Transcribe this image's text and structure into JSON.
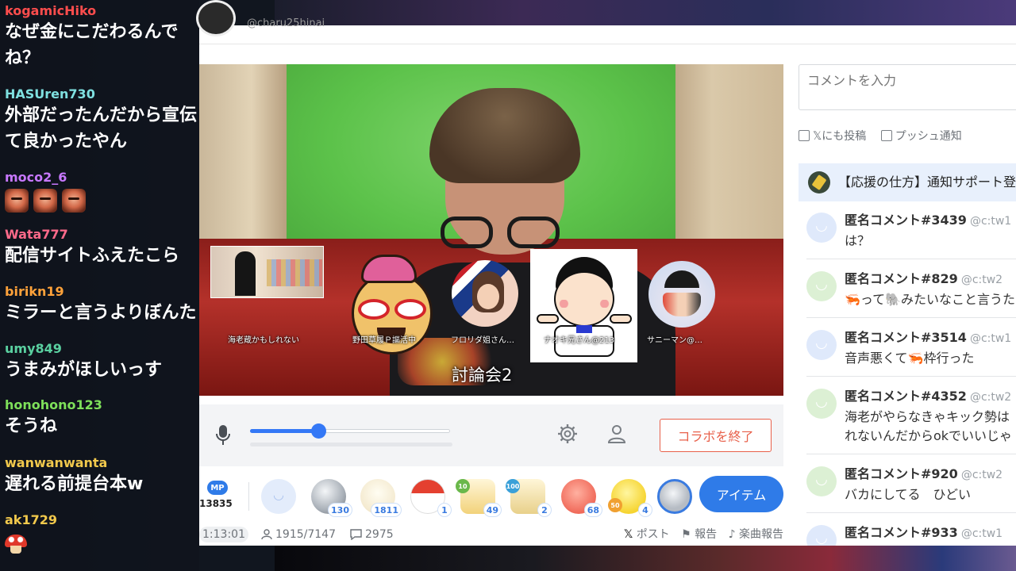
{
  "chat": {
    "messages": [
      {
        "user": "kogamicHiko",
        "color": "#ff4d4d",
        "lines": [
          "なぜ金にこだわるんで",
          "ね？"
        ]
      },
      {
        "user": "HASUren730",
        "color": "#7fe0e0",
        "lines": [
          "外部だったんだから宣伝",
          "て良かったやん"
        ]
      },
      {
        "user": "moco2_6",
        "color": "#c878ff",
        "lines": [],
        "emotes": [
          "face-emote",
          "face-emote",
          "face-emote"
        ]
      },
      {
        "user": "Wata777",
        "color": "#ff6a8a",
        "lines": [
          "配信サイトふえたこら"
        ]
      },
      {
        "user": "birikn19",
        "color": "#ffa23a",
        "lines": [
          "ミラーと言うよりぼんた"
        ]
      },
      {
        "user": "umy849",
        "color": "#5ad0a0",
        "lines": [
          "うまみがほしいっす"
        ]
      },
      {
        "user": "honohono123",
        "color": "#7ee05a",
        "lines": [
          "そうね"
        ]
      },
      {
        "user": "wanwanwanta",
        "color": "#f2c94c",
        "lines": [
          "遅れる前提台本w"
        ]
      },
      {
        "user": "ak1729",
        "color": "#f2c94c",
        "lines": [],
        "emotes": [
          "mushroom-emote"
        ]
      }
    ]
  },
  "header": {
    "handle": "@charu25hinai"
  },
  "video": {
    "participants": [
      {
        "label": "海老蔵かもしれない"
      },
      {
        "label": "野田草履Ｐ謳活中"
      },
      {
        "label": "フロリダ姐さん…"
      },
      {
        "label": "ナオキ兄さん@213"
      },
      {
        "label": "サニーマン@…"
      }
    ],
    "title": "討論会2"
  },
  "controls": {
    "volume": 0.34,
    "end_collab_label": "コラボを終了",
    "icons": [
      "mic-icon",
      "gear-icon",
      "user-icon"
    ]
  },
  "items": {
    "mp_label": "MP",
    "mp_points": "13835",
    "gifts": [
      {
        "name": "smile-face",
        "count": ""
      },
      {
        "name": "coin",
        "count": "130"
      },
      {
        "name": "bun",
        "count": "1811"
      },
      {
        "name": "sushi",
        "count": "1"
      },
      {
        "name": "drink-10",
        "count": "49",
        "tag": "10"
      },
      {
        "name": "drink-100",
        "count": "2",
        "tag": "100"
      },
      {
        "name": "pink-blob",
        "count": "68"
      },
      {
        "name": "yellow-chick",
        "count": "4",
        "tag": "50"
      },
      {
        "name": "coin-select",
        "count": ""
      }
    ],
    "item_button_label": "アイテム"
  },
  "stats": {
    "elapsed": "1:13:01",
    "viewers": "1915/7147",
    "comments": "2975",
    "post_label": "ポスト",
    "report_label": "報告",
    "song_report_label": "楽曲報告"
  },
  "comment_panel": {
    "input_placeholder": "コメントを入力",
    "post_x_label": "𝕏にも投稿",
    "push_label": "プッシュ通知",
    "notice": "【応援の仕方】通知サポート登録",
    "comments": [
      {
        "name": "匿名コメント#3439",
        "id": "@c:tw1",
        "text": "は？",
        "avatar": "blue"
      },
      {
        "name": "匿名コメント#829",
        "id": "@c:tw2",
        "text": "🦐って🐘みたいなこと言うた",
        "avatar": "green"
      },
      {
        "name": "匿名コメント#3514",
        "id": "@c:tw1",
        "text": "音声悪くて🦐枠行った",
        "avatar": "blue"
      },
      {
        "name": "匿名コメント#4352",
        "id": "@c:tw2",
        "text": "海老がやらなきゃキック勢は",
        "text2": "れないんだからokでいいじゃ",
        "avatar": "green"
      },
      {
        "name": "匿名コメント#920",
        "id": "@c:tw2",
        "text": "バカにしてる　ひどい",
        "avatar": "green"
      },
      {
        "name": "匿名コメント#933",
        "id": "@c:tw1",
        "text": "",
        "avatar": "blue"
      }
    ]
  }
}
